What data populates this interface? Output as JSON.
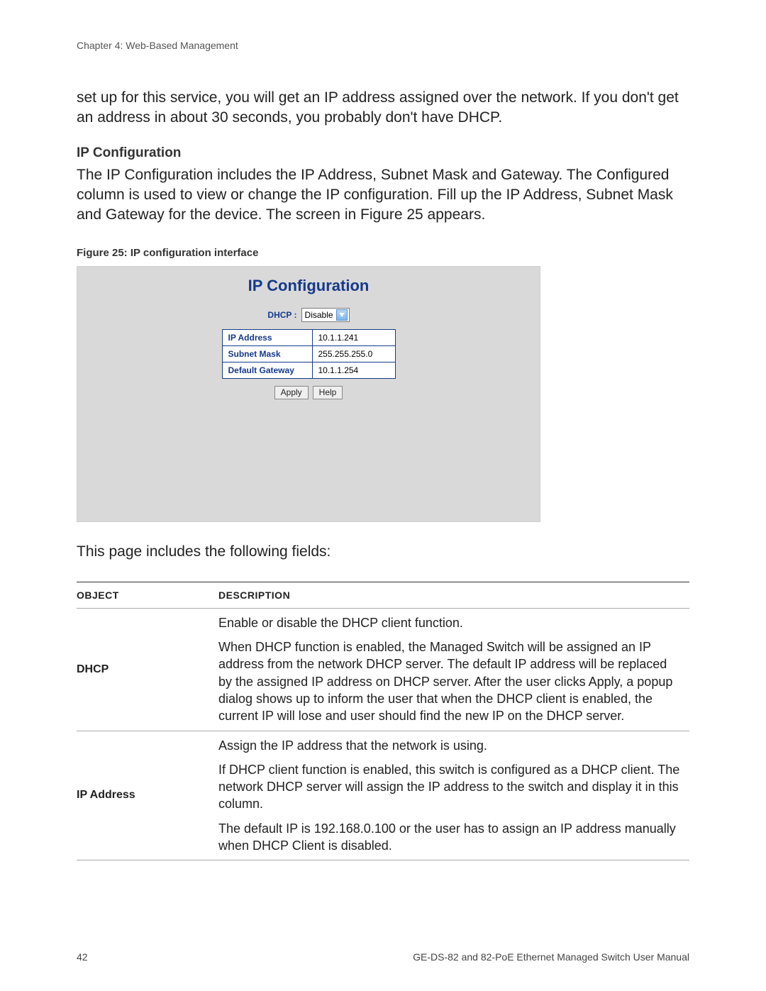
{
  "header": {
    "chapter": "Chapter 4: Web-Based Management"
  },
  "intro_paragraph": "set up for this service, you will get an IP address assigned over the network. If you don't get an address in about 30 seconds, you probably don't have DHCP.",
  "ip_config": {
    "heading": "IP Configuration",
    "paragraph": "The IP Configuration includes the IP Address, Subnet Mask and Gateway. The Configured column is used to view or change the IP configuration. Fill up the IP Address, Subnet Mask and Gateway for the device. The screen in Figure 25 appears.",
    "figure_caption": "Figure 25:  IP configuration interface"
  },
  "figure": {
    "title": "IP Configuration",
    "dhcp_label": "DHCP :",
    "dhcp_value": "Disable",
    "rows": {
      "ip_address_label": "IP Address",
      "ip_address_value": "10.1.1.241",
      "subnet_mask_label": "Subnet Mask",
      "subnet_mask_value": "255.255.255.0",
      "gateway_label": "Default Gateway",
      "gateway_value": "10.1.1.254"
    },
    "buttons": {
      "apply": "Apply",
      "help": "Help"
    }
  },
  "fields_intro": "This page includes the following fields:",
  "fields_table": {
    "headers": {
      "object": "Object",
      "description": "Description"
    },
    "rows": [
      {
        "object": "DHCP",
        "description": [
          "Enable or disable the DHCP client function.",
          "When DHCP function is enabled, the Managed Switch will be assigned an IP address from the network DHCP server. The default IP address will be replaced by the assigned IP address on DHCP server. After the user clicks Apply, a popup dialog shows up to inform the user that when the DHCP client is enabled, the current IP will lose and user should find the new IP on the DHCP server."
        ]
      },
      {
        "object": "IP Address",
        "description": [
          "Assign the IP address that the network is using.",
          "If DHCP client function is enabled, this switch is configured as a DHCP client. The network DHCP server will assign the IP address to the switch and display it in this column.",
          "The default IP is 192.168.0.100 or the user has to assign an IP address manually when DHCP Client is disabled."
        ]
      }
    ]
  },
  "footer": {
    "page_number": "42",
    "manual_title": "GE-DS-82 and 82-PoE Ethernet Managed Switch User Manual"
  }
}
